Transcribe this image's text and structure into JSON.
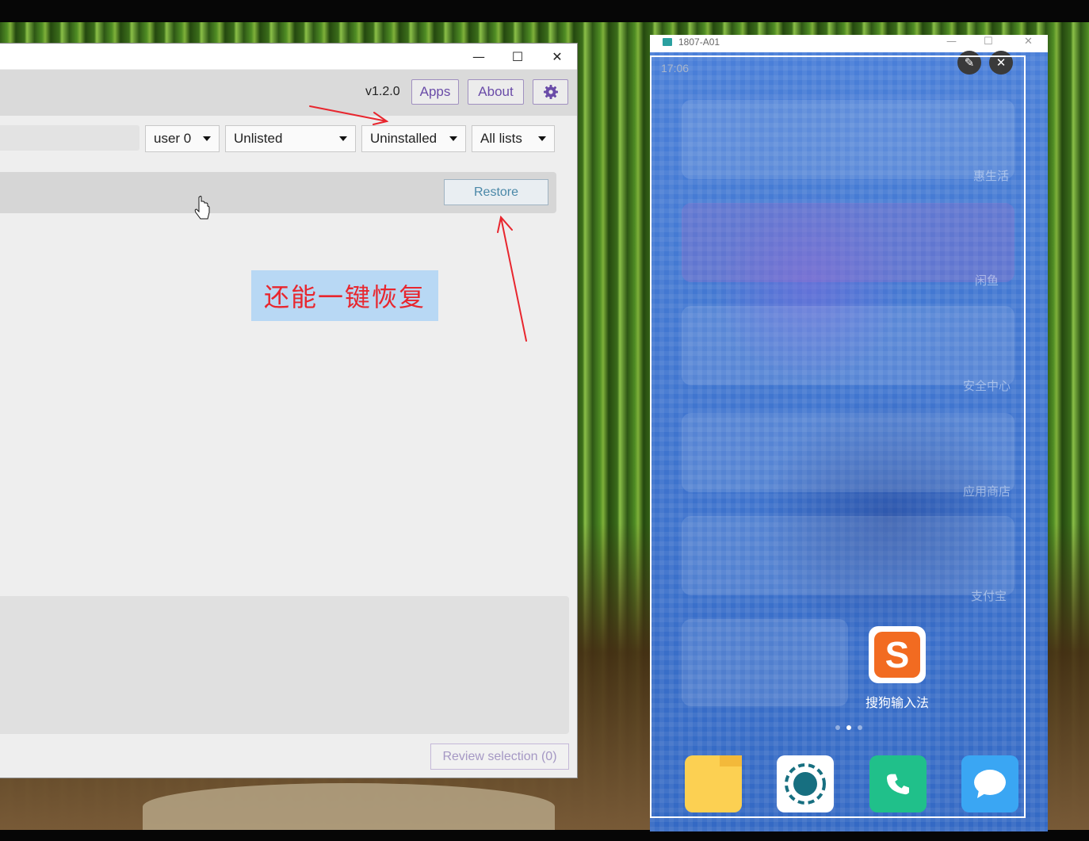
{
  "app": {
    "window_controls": {
      "minimize": "—",
      "maximize": "☐",
      "close": "✕"
    },
    "version": "v1.2.0",
    "nav": {
      "apps": "Apps",
      "about": "About"
    },
    "filters": {
      "user": "user 0",
      "list_state": "Unlisted",
      "install_state": "Uninstalled",
      "lists": "All lists"
    },
    "restore_label": "Restore",
    "annotation": "还能一键恢复",
    "review_label": "Review selection (0)"
  },
  "phone": {
    "window_title": "1807-A01",
    "status_time": "17:06",
    "side_labels": [
      "惠生活",
      "闲鱼",
      "安全中心",
      "应用商店",
      "支付宝"
    ],
    "featured_app": "搜狗输入法",
    "featured_icon": "S",
    "colors": {
      "sogou": "#f26b21",
      "files": "#fcd052",
      "phone": "#20c08a",
      "messages": "#3aa6f3"
    }
  }
}
